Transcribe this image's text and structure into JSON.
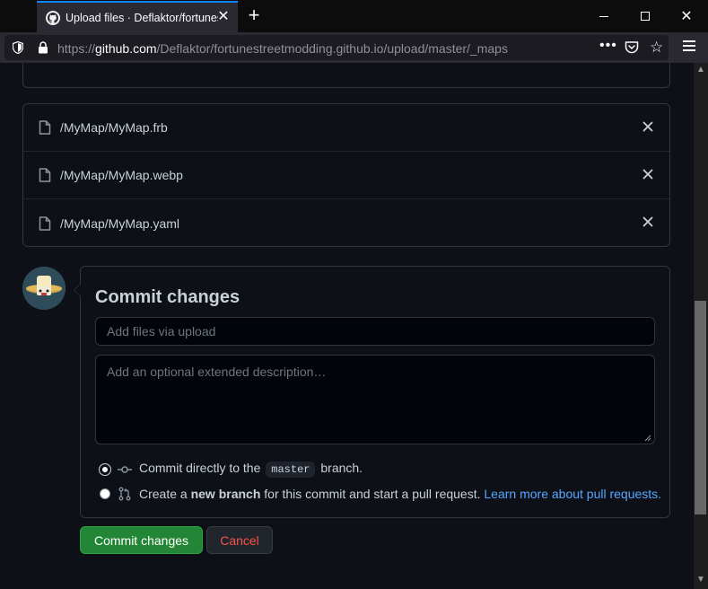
{
  "browser": {
    "tab_title": "Upload files · Deflaktor/fortunestreetmodding.github.io",
    "url_prefix": "https://",
    "url_host": "github.com",
    "url_path": "/Deflaktor/fortunestreetmodding.github.io/upload/master/_maps",
    "icons": {
      "tab_favicon": "github-icon",
      "tab_close": "close-icon",
      "new_tab": "plus-icon",
      "shield": "shield-icon",
      "lock": "lock-icon",
      "page_actions": "more-icon",
      "pocket": "pocket-icon",
      "bookmark": "star-icon",
      "menu": "hamburger-icon"
    }
  },
  "files": [
    {
      "name": "/MyMap/MyMap.frb"
    },
    {
      "name": "/MyMap/MyMap.webp"
    },
    {
      "name": "/MyMap/MyMap.yaml"
    }
  ],
  "commit": {
    "title": "Commit changes",
    "summary_placeholder": "Add files via upload",
    "description_placeholder": "Add an optional extended description…",
    "option_direct": {
      "prefix": "Commit directly to the",
      "branch": "master",
      "suffix": "branch.",
      "selected": true
    },
    "option_new_branch": {
      "prefix": "Create a",
      "strong": "new branch",
      "suffix": "for this commit and start a pull request.",
      "link": "Learn more about pull requests.",
      "selected": false
    },
    "submit_label": "Commit changes",
    "cancel_label": "Cancel"
  },
  "colors": {
    "page_bg": "#0d1117",
    "border": "#30363d",
    "primary_green": "#238636",
    "cancel_red": "#f85149",
    "link_blue": "#58a6ff",
    "text": "#c9d1d9"
  }
}
